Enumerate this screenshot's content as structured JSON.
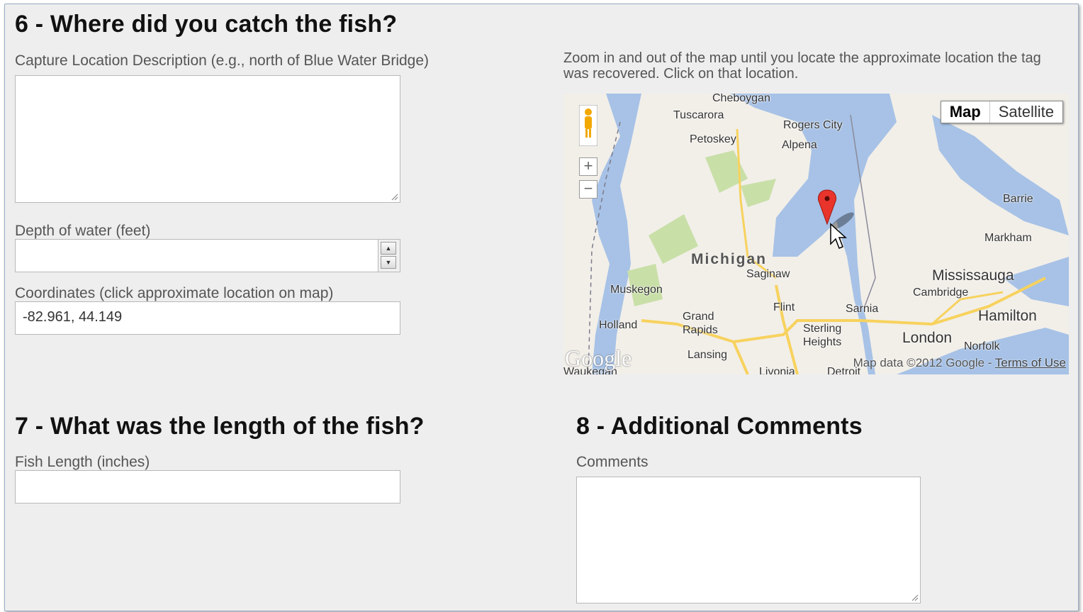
{
  "section6": {
    "heading": "6 - Where did you catch the fish?",
    "location_label": "Capture Location Description (e.g., north of Blue Water Bridge)",
    "location_value": "",
    "depth_label": "Depth of water (feet)",
    "depth_value": "",
    "coords_label": "Coordinates (click approximate location on map)",
    "coords_value": "-82.961, 44.149",
    "map_instructions": "Zoom in and out of the map until you locate the approximate location the tag was recovered. Click on that location."
  },
  "map": {
    "type_buttons": [
      "Map",
      "Satellite"
    ],
    "active_type": "Map",
    "zoom_in": "+",
    "zoom_out": "−",
    "state_label": "Michigan",
    "cities": [
      "Cheboygan",
      "Tuscarora",
      "Petoskey",
      "Rogers City",
      "Alpena",
      "Muskegon",
      "Saginaw",
      "Flint",
      "Sarnia",
      "Grand Rapids",
      "Holland",
      "Lansing",
      "Sterling Heights",
      "London",
      "Norfolk",
      "Hamilton",
      "Cambridge",
      "Mississauga",
      "Markham",
      "Barrie",
      "Livonia",
      "Detroit",
      "Waukegan"
    ],
    "copyright": "Map data ©2012 Google - ",
    "terms": "Terms of Use",
    "logo": "Google",
    "colors": {
      "water": "#a7c2e6",
      "land": "#f2efe9",
      "park": "#c9dfa8",
      "road": "#f7d25e",
      "marker": "#e8342b"
    }
  },
  "section7": {
    "heading": "7 - What was the length of the fish?",
    "length_label": "Fish Length (inches)",
    "length_value": ""
  },
  "section8": {
    "heading": "8 - Additional Comments",
    "comments_label": "Comments",
    "comments_value": ""
  }
}
